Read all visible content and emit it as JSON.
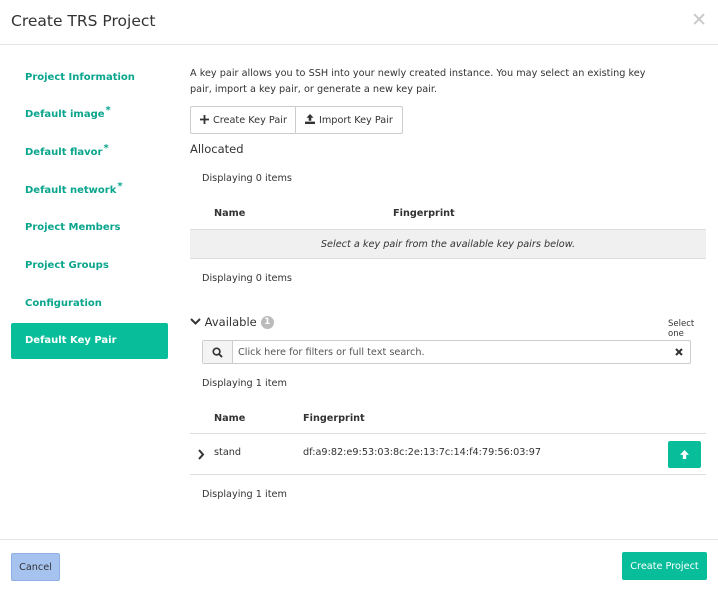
{
  "modal": {
    "title": "Create TRS Project",
    "close_glyph": "✕"
  },
  "sidebar": {
    "items": [
      {
        "label": "Project Information",
        "required": false,
        "active": false
      },
      {
        "label": "Default image",
        "required": true,
        "active": false
      },
      {
        "label": "Default flavor",
        "required": true,
        "active": false
      },
      {
        "label": "Default network",
        "required": true,
        "active": false
      },
      {
        "label": "Project Members",
        "required": false,
        "active": false
      },
      {
        "label": "Project Groups",
        "required": false,
        "active": false
      },
      {
        "label": "Configuration",
        "required": false,
        "active": false
      },
      {
        "label": "Default Key Pair",
        "required": false,
        "active": true
      }
    ],
    "required_marker": "*"
  },
  "keypair": {
    "help_text": "A key pair allows you to SSH into your newly created instance. You may select an existing key pair, import a key pair, or generate a new key pair.",
    "create_label": "Create Key Pair",
    "import_label": "Import Key Pair",
    "create_icon": "plus-icon",
    "import_icon": "upload-icon"
  },
  "allocated": {
    "title": "Allocated",
    "count_top": "Displaying 0 items",
    "col_name": "Name",
    "col_fingerprint": "Fingerprint",
    "empty_message": "Select a key pair from the available key pairs below.",
    "count_bottom": "Displaying 0 items"
  },
  "available": {
    "title": "Available",
    "info_badge": "1",
    "select_hint": "Select one",
    "search_placeholder": "Click here for filters or full text search.",
    "count_top": "Displaying 1 item",
    "col_name": "Name",
    "col_fingerprint": "Fingerprint",
    "rows": [
      {
        "name": "stand",
        "fingerprint": "df:a9:82:e9:53:03:8c:2e:13:7c:14:f4:79:56:03:97"
      }
    ],
    "count_bottom": "Displaying 1 item"
  },
  "footer": {
    "cancel_label": "Cancel",
    "create_label": "Create Project"
  },
  "colors": {
    "accent": "#07bd9a",
    "link": "#0aa58d",
    "cancel_bg": "#a6c3ef"
  }
}
